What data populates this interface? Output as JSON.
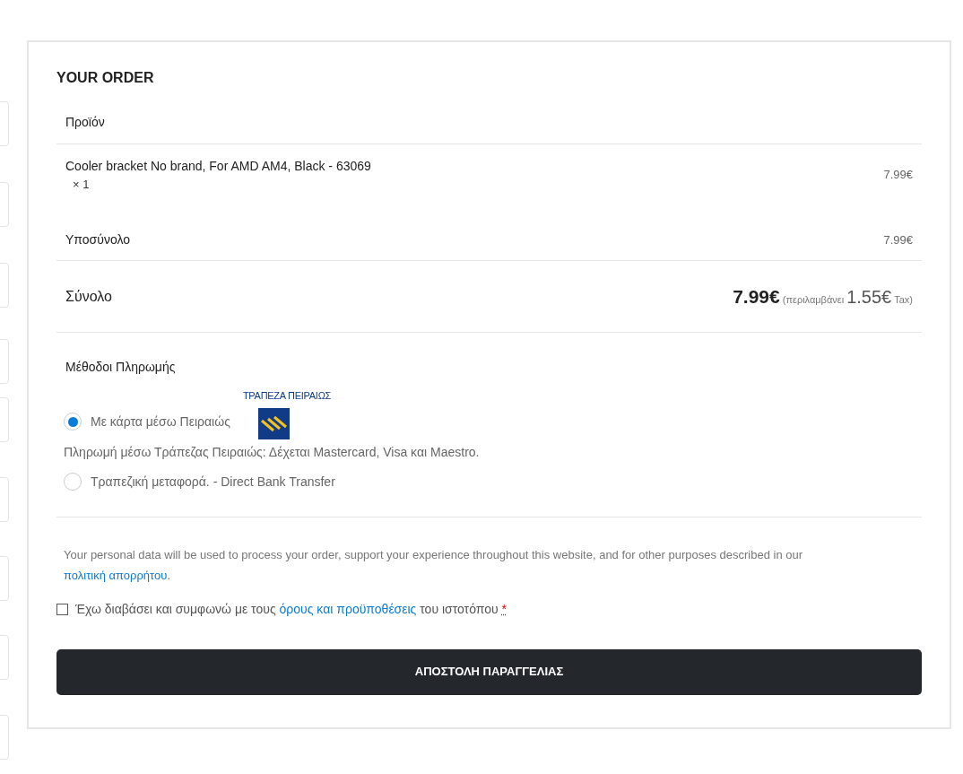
{
  "order": {
    "title": "YOUR ORDER",
    "header": "Προϊόν",
    "items": [
      {
        "name": "Cooler bracket No brand, For AMD AM4, Black - 63069",
        "qty": "× 1",
        "price": "7.99€"
      }
    ],
    "subtotal": {
      "label": "Υποσύνολο",
      "value": "7.99€"
    },
    "total": {
      "label": "Σύνολο",
      "amount": "7.99€",
      "includes": "(περιλαμβάνει",
      "tax_amount": "1.55€",
      "tax_label": "Tax)"
    }
  },
  "payment": {
    "title": "Μέθοδοι Πληρωμής",
    "methods": [
      {
        "label": "Με κάρτα μέσω Πειραιώς",
        "selected": true,
        "logo_text": "ΤΡΑΠΕΖΑ ΠΕΙΡΑΙΩΣ",
        "description": "Πληρωμή μέσω Τράπεζας Πειραιώς: Δέχεται Mastercard, Visa και Maestro."
      },
      {
        "label": "Τραπεζική μεταφορά. - Direct Bank Transfer",
        "selected": false
      }
    ]
  },
  "privacy": {
    "text": "Your personal data will be used to process your order, support your experience throughout this website, and for other purposes described in our",
    "link": "πολιτική απορρήτου",
    "end": "."
  },
  "terms": {
    "checked": false,
    "before": "Έχω διαβάσει και συμφωνώ με τους",
    "link": "όρους και προϋποθέσεις",
    "after": "του ιστοτόπου",
    "required": "*"
  },
  "submit": "ΑΠΟΣΤΟΛΗ ΠΑΡΑΓΓΕΛΙΑΣ"
}
